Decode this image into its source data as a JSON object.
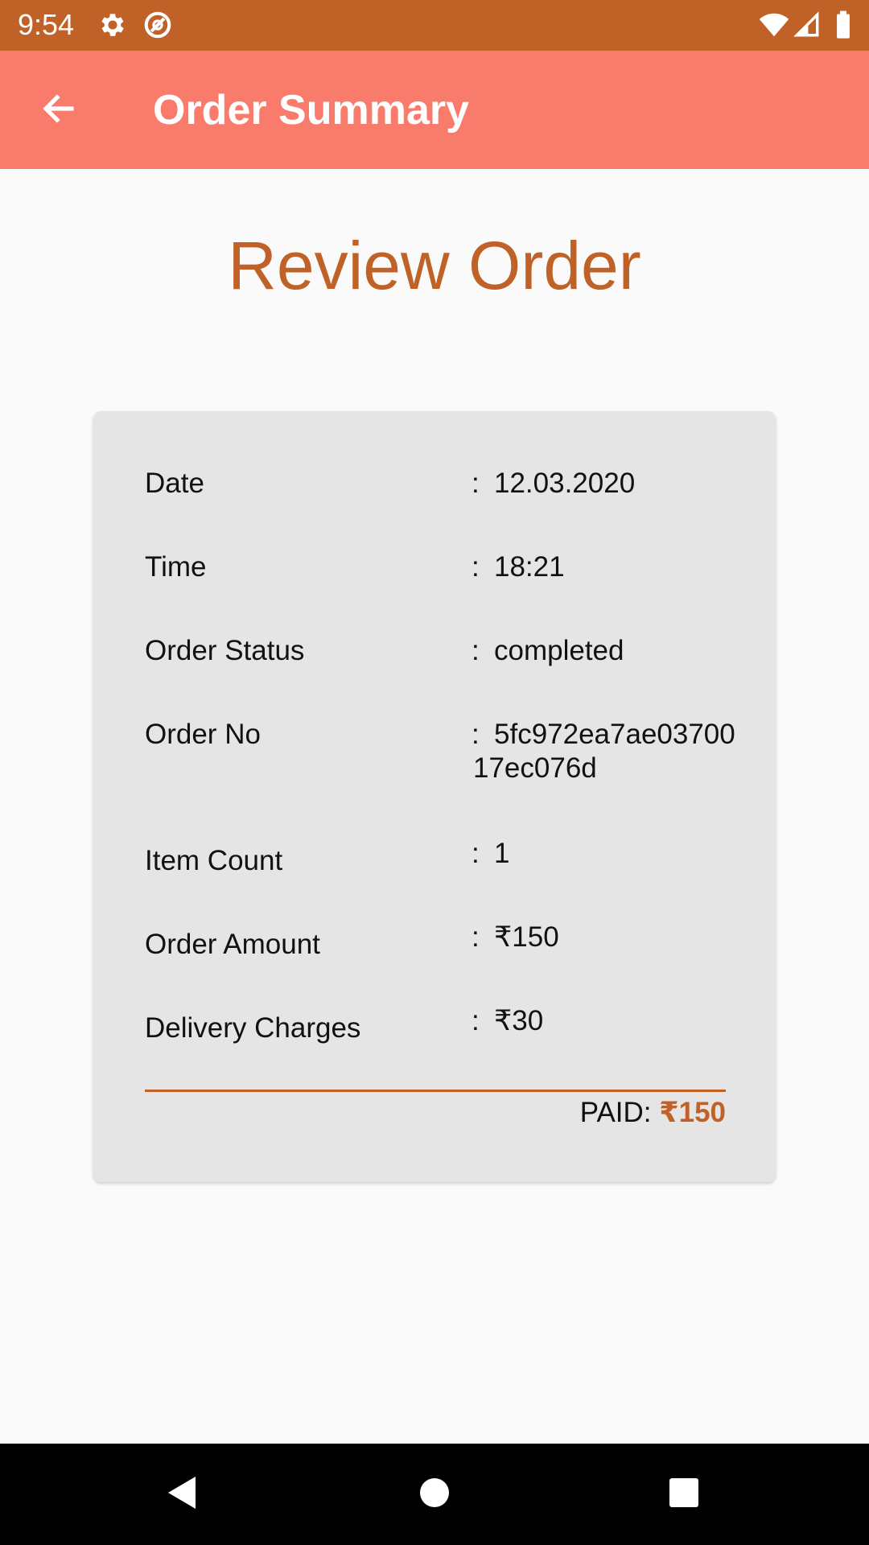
{
  "status_bar": {
    "time": "9:54",
    "icons": [
      "settings-gear-icon",
      "no-disturb-icon",
      "wifi-icon",
      "cell-signal-icon",
      "battery-icon"
    ],
    "background": "#c06227"
  },
  "app_bar": {
    "title": "Order Summary",
    "back_icon": "arrow-left-icon",
    "background": "#f87b6b"
  },
  "page": {
    "heading": "Review Order",
    "accent": "#c06227"
  },
  "order": {
    "rows": [
      {
        "label": "Date",
        "colon": ":",
        "value": "12.03.2020"
      },
      {
        "label": "Time",
        "colon": ":",
        "value": "18:21"
      },
      {
        "label": "Order Status",
        "colon": ":",
        "value": "completed"
      },
      {
        "label": "Order No",
        "colon": ":",
        "value": "5fc972ea7ae0370017ec076d"
      },
      {
        "label": "Item Count",
        "colon": ":",
        "value": "1"
      },
      {
        "label": "Order Amount",
        "colon": ":",
        "value": "₹150"
      },
      {
        "label": "Delivery Charges",
        "colon": ":",
        "value": "₹30"
      }
    ],
    "paid_label": "PAID: ",
    "paid_amount": "₹150"
  },
  "nav_bar": {
    "icons": [
      "back-triangle-icon",
      "home-circle-icon",
      "recents-square-icon"
    ]
  }
}
